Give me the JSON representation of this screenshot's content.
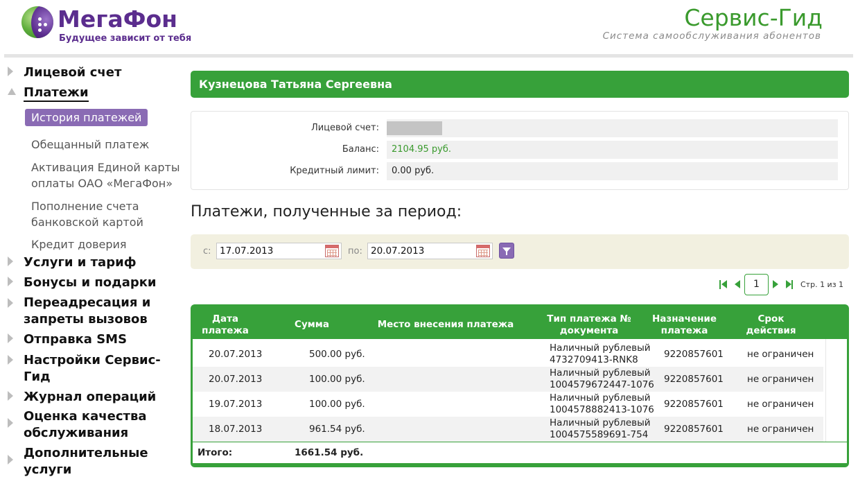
{
  "header": {
    "logo_title": "МегаФон",
    "logo_tagline": "Будущее зависит от тебя",
    "service_title": "Сервис-Гид",
    "service_subtitle": "Система самообслуживания абонентов"
  },
  "sidebar": {
    "items": [
      {
        "label": "Лицевой счет",
        "state": "collapsed"
      },
      {
        "label": "Платежи",
        "state": "expanded",
        "active": true
      },
      {
        "label": "Услуги и тариф",
        "state": "collapsed"
      },
      {
        "label": "Бонусы и подарки",
        "state": "collapsed"
      },
      {
        "label": "Переадресация и запреты вызовов",
        "state": "collapsed"
      },
      {
        "label": "Отправка SMS",
        "state": "collapsed"
      },
      {
        "label": "Настройки Сервис-Гид",
        "state": "collapsed"
      },
      {
        "label": "Журнал операций",
        "state": "collapsed"
      },
      {
        "label": "Оценка качества обслуживания",
        "state": "collapsed"
      },
      {
        "label": "Дополнительные услуги",
        "state": "collapsed"
      }
    ],
    "payments_sub": [
      {
        "label": "История платежей",
        "active": true
      },
      {
        "label": "Обещанный платеж"
      },
      {
        "label": "Активация Единой карты оплаты ОАО «МегаФон»"
      },
      {
        "label": "Пополнение счета банковской картой"
      },
      {
        "label": "Кредит доверия"
      }
    ]
  },
  "account": {
    "name": "Кузнецова Татьяна Сергеевна",
    "account_label": "Лицевой счет:",
    "account_value": "",
    "balance_label": "Баланс:",
    "balance_value": "2104.95 руб.",
    "credit_label": "Кредитный лимит:",
    "credit_value": "0.00 руб."
  },
  "period": {
    "title": "Платежи, полученные за период:",
    "from_label": "с:",
    "from_value": "17.07.2013",
    "to_label": "по:",
    "to_value": "20.07.2013"
  },
  "pagination": {
    "current_page": "1",
    "status_text": "Стр. 1 из 1"
  },
  "table": {
    "headers": [
      "Дата платежа",
      "Сумма",
      "Место внесения платежа",
      "Тип платежа № документа",
      "Назначение платежа",
      "Срок действия"
    ],
    "rows": [
      {
        "date": "20.07.2013",
        "amount": "500.00 руб.",
        "place": "",
        "type": "Наличный рублевый",
        "doc": "4732709413-RNK8",
        "purpose": "9220857601",
        "term": "не ограничен"
      },
      {
        "date": "20.07.2013",
        "amount": "100.00 руб.",
        "place": "",
        "type": "Наличный рублевый",
        "doc": "1004579672447-1076",
        "purpose": "9220857601",
        "term": "не ограничен"
      },
      {
        "date": "19.07.2013",
        "amount": "100.00 руб.",
        "place": "",
        "type": "Наличный рублевый",
        "doc": "1004578882413-1076",
        "purpose": "9220857601",
        "term": "не ограничен"
      },
      {
        "date": "18.07.2013",
        "amount": "961.54 руб.",
        "place": "",
        "type": "Наличный рублевый",
        "doc": "1004575589691-754",
        "purpose": "9220857601",
        "term": "не ограничен"
      }
    ],
    "total_label": "Итого:",
    "total_value": "1661.54 руб."
  },
  "colors": {
    "brand_green": "#37a13a",
    "brand_purple": "#5b2d8e",
    "accent_purple": "#8a6bb4",
    "filter_bg": "#f2f0e0"
  }
}
